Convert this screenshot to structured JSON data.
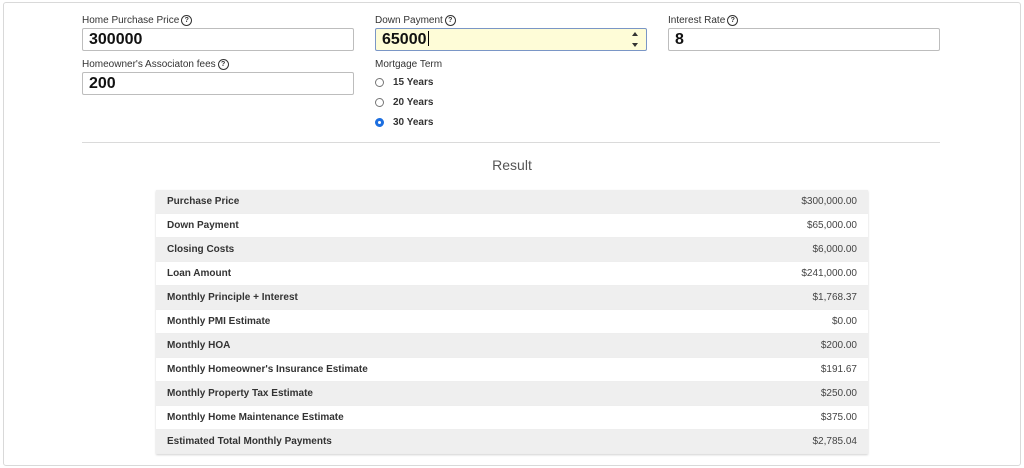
{
  "form": {
    "home_price": {
      "label": "Home Purchase Price",
      "value": "300000"
    },
    "down_payment": {
      "label": "Down Payment",
      "value": "65000"
    },
    "interest_rate": {
      "label": "Interest Rate",
      "value": "8"
    },
    "hoa_fees": {
      "label": "Homeowner's Associaton fees",
      "value": "200"
    },
    "mortgage_term": {
      "label": "Mortgage Term",
      "options": [
        {
          "label": "15 Years",
          "checked": false
        },
        {
          "label": "20 Years",
          "checked": false
        },
        {
          "label": "30 Years",
          "checked": true
        }
      ]
    },
    "help_glyph": "?"
  },
  "result": {
    "heading": "Result",
    "rows": [
      {
        "label": "Purchase Price",
        "value": "$300,000.00"
      },
      {
        "label": "Down Payment",
        "value": "$65,000.00"
      },
      {
        "label": "Closing Costs",
        "value": "$6,000.00"
      },
      {
        "label": "Loan Amount",
        "value": "$241,000.00"
      },
      {
        "label": "Monthly Principle + Interest",
        "value": "$1,768.37"
      },
      {
        "label": "Monthly PMI Estimate",
        "value": "$0.00"
      },
      {
        "label": "Monthly HOA",
        "value": "$200.00"
      },
      {
        "label": "Monthly Homeowner's Insurance Estimate",
        "value": "$191.67"
      },
      {
        "label": "Monthly Property Tax Estimate",
        "value": "$250.00"
      },
      {
        "label": "Monthly Home Maintenance Estimate",
        "value": "$375.00"
      },
      {
        "label": "Estimated Total Monthly Payments",
        "value": "$2,785.04"
      }
    ]
  },
  "colors": {
    "focused_input_bg": "#fefcd7",
    "radio_checked": "#1d6fe0"
  }
}
